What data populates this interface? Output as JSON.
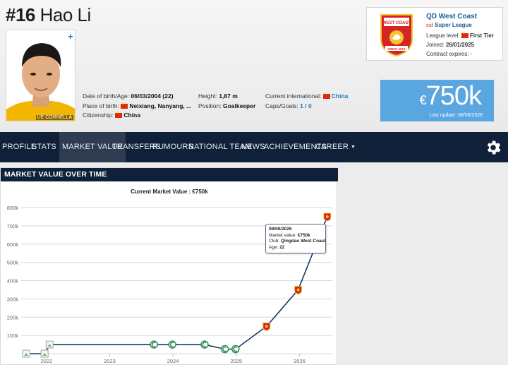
{
  "player": {
    "number": "#16",
    "name": "Hao Li",
    "photo_caption": "UE CORNELLÀ",
    "dob_label": "Date of birth/Age:",
    "dob_value": "06/03/2004 (22)",
    "pob_label": "Place of birth:",
    "pob_value": "Neixiang, Nanyang, ...",
    "citizenship_label": "Citizenship:",
    "citizenship_value": "China",
    "height_label": "Height:",
    "height_value": "1,87 m",
    "position_label": "Position:",
    "position_value": "Goalkeeper",
    "intl_label": "Current international:",
    "intl_value": "China",
    "caps_label": "Caps/Goals:",
    "caps_value": "1 / 0"
  },
  "club": {
    "name": "QD West Coast",
    "league": "Super League",
    "level_label": "League level:",
    "level_value": "First Tier",
    "joined_label": "Joined:",
    "joined_value": "26/01/2025",
    "expires_label": "Contract expires:",
    "expires_value": "-",
    "logo_text_top": "WEST COAST",
    "logo_text_bottom": "SINCE 2013"
  },
  "market_value": {
    "currency": "€",
    "amount": "750k",
    "last_update": "Last update: 08/06/2026"
  },
  "nav": {
    "items": [
      {
        "label": "PROFILE"
      },
      {
        "label": "STATS"
      },
      {
        "label": "MARKET VALUE"
      },
      {
        "label": "TRANSFERS"
      },
      {
        "label": "RUMOURS"
      },
      {
        "label": "NATIONAL TEAM"
      },
      {
        "label": "NEWS"
      },
      {
        "label": "ACHIEVEMENTS"
      },
      {
        "label": "CAREER"
      }
    ],
    "active": "MARKET VALUE",
    "settings_icon": "gear-icon"
  },
  "panel": {
    "heading": "MARKET VALUE OVER TIME"
  },
  "tooltip": {
    "date": "08/06/2026",
    "mv_label": "Market value:",
    "mv_value": "€750k",
    "club_label": "Club:",
    "club_value": "Qingdao West Coast",
    "age_label": "Age:",
    "age_value": "22"
  },
  "colors": {
    "nav_bg": "#0f2038",
    "mv_box": "#5aa6e0",
    "line": "#1b3a66",
    "link": "#1a7bc0"
  },
  "chart_data": {
    "type": "line",
    "title": "Current Market Value : €750k",
    "xlabel": "",
    "ylabel": "",
    "x_ticks": [
      "2022",
      "2023",
      "2024",
      "2025",
      "2026"
    ],
    "y_ticks": [
      "",
      "100k",
      "200k",
      "300k",
      "400k",
      "500k",
      "600k",
      "700k",
      "800k"
    ],
    "ylim": [
      0,
      800
    ],
    "grid": true,
    "series": [
      {
        "values_k": [
          {
            "x": 2021.68,
            "y": 0,
            "marker": "blank"
          },
          {
            "x": 2021.97,
            "y": 0,
            "marker": "blank"
          },
          {
            "x": 2022.05,
            "y": 50,
            "marker": "blank"
          },
          {
            "x": 2023.7,
            "y": 50,
            "marker": "green"
          },
          {
            "x": 2023.99,
            "y": 50,
            "marker": "green"
          },
          {
            "x": 2024.5,
            "y": 50,
            "marker": "green"
          },
          {
            "x": 2024.82,
            "y": 25,
            "marker": "green"
          },
          {
            "x": 2024.99,
            "y": 25,
            "marker": "green"
          },
          {
            "x": 2025.48,
            "y": 150,
            "marker": "red"
          },
          {
            "x": 2025.98,
            "y": 350,
            "marker": "red"
          },
          {
            "x": 2026.44,
            "y": 750,
            "marker": "red"
          }
        ]
      }
    ]
  }
}
